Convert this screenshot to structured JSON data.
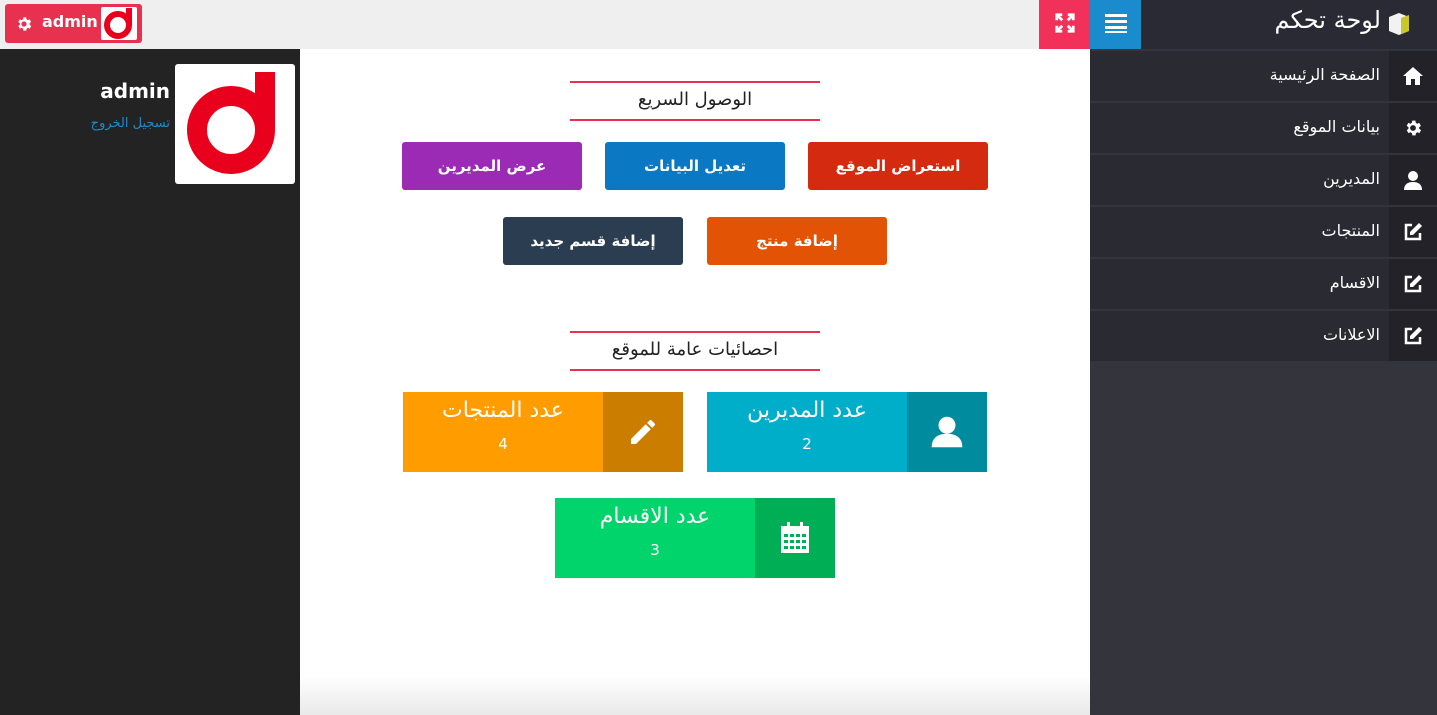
{
  "brand": {
    "title": "لوحة تحكم"
  },
  "topbar": {
    "admin_name": "admin"
  },
  "profile": {
    "name": "admin",
    "logout": "تسجيل الخروج"
  },
  "sidebar": {
    "items": [
      {
        "label": "الصفحة الرئيسية",
        "icon": "home-icon"
      },
      {
        "label": "بيانات الموقع",
        "icon": "gear-icon"
      },
      {
        "label": "المديرين",
        "icon": "user-icon"
      },
      {
        "label": "المنتجات",
        "icon": "edit-icon"
      },
      {
        "label": "الاقسام",
        "icon": "edit-icon"
      },
      {
        "label": "الاعلانات",
        "icon": "edit-icon"
      }
    ]
  },
  "quick_access": {
    "title": "الوصول السريع",
    "buttons": [
      {
        "label": "استعراض الموقع",
        "color": "#d42a10"
      },
      {
        "label": "تعديل البيانات",
        "color": "#0a78c2"
      },
      {
        "label": "عرض المديرين",
        "color": "#9b2bb5"
      },
      {
        "label": "إضافة منتج",
        "color": "#e25306"
      },
      {
        "label": "إضافة قسم جديد",
        "color": "#2b3e51"
      }
    ]
  },
  "stats": {
    "title": "احصائيات عامة للموقع",
    "cards": [
      {
        "label": "عدد المديرين",
        "value": "2",
        "color": "#00aec9",
        "icon_color": "#008c9e",
        "icon": "user-icon"
      },
      {
        "label": "عدد المنتجات",
        "value": "4",
        "color": "#ff9c00",
        "icon_color": "#cb7d00",
        "icon": "pencil-icon"
      },
      {
        "label": "عدد الاقسام",
        "value": "3",
        "color": "#00d46a",
        "icon_color": "#00ae56",
        "icon": "calendar-icon"
      }
    ]
  },
  "colors": {
    "accent": "#e8304f",
    "primary": "#1a8ccd"
  }
}
